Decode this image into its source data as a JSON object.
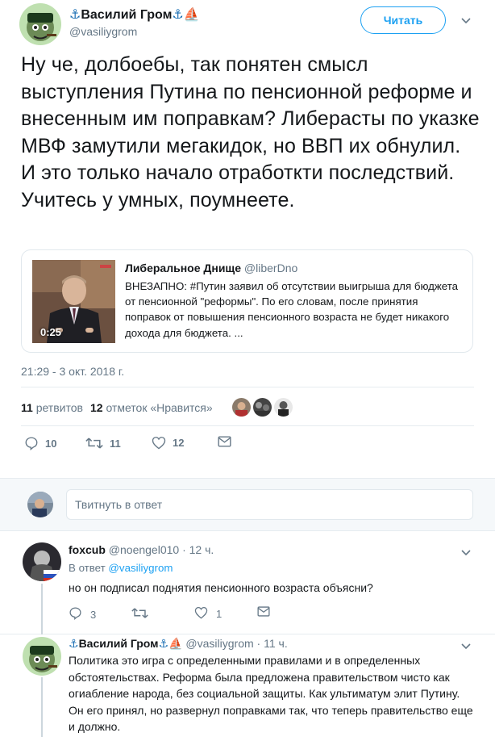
{
  "main_tweet": {
    "display_name": "Василий Гром",
    "handle": "@vasiliygrom",
    "follow_label": "Читать",
    "text": "Ну че, долбоебы, так понятен смысл выступления Путина по пенсионной реформе и внесенным им поправкам? Либерасты по указке МВФ замутили мегакидок, но ВВП их обнулил. И это только начало отработкти последствий. Учитесь у умных, поумнеете.",
    "quote": {
      "author_name": "Либеральное Днище",
      "author_handle": "@liberDno",
      "text": "ВНЕЗАПНО: #Путин заявил об отсутствии выигрыша для бюджета от пенсионной \"реформы\". По его словам, после принятия поправок от повышения пенсионного возраста не будет никакого дохода для бюджета. ...",
      "video_duration": "0:25"
    },
    "timestamp": "21:29 - 3 окт. 2018 г.",
    "retweets_count": "11",
    "retweets_label": "ретвитов",
    "likes_count": "12",
    "likes_label": "отметок «Нравится»",
    "actions": {
      "reply_count": "10",
      "retweet_count": "11",
      "like_count": "12"
    }
  },
  "reply_box": {
    "placeholder": "Твитнуть в ответ"
  },
  "replies": [
    {
      "display_name": "foxcub",
      "handle": "@noengel010",
      "time": "12 ч.",
      "in_reply_prefix": "В ответ",
      "in_reply_to": "@vasiliygrom",
      "text": "но он подписал поднятия пенсионного возраста объясни?",
      "reply_count": "3",
      "retweet_count": "",
      "like_count": "1"
    },
    {
      "display_name": "Василий Гром",
      "handle": "@vasiliygrom",
      "time": "11 ч.",
      "text": "Политика это игра с определенными правилами и в определенных обстоятельствах. Реформа была предложена правительством чисто как огиабление народа, без социальной защиты. Как ультиматум элит Путину. Он его принял, но развернул поправками так, что теперь правительство еще и должно."
    }
  ],
  "colors": {
    "accent": "#1da1f2",
    "text_primary": "#14171a",
    "text_secondary": "#657786",
    "border": "#e6ecf0",
    "reply_box_bg": "#f5f8fa"
  },
  "icons": {
    "anchor": "anchor-icon",
    "sailboat": "sailboat-icon",
    "reply": "reply-icon",
    "retweet": "retweet-icon",
    "like": "heart-icon",
    "message": "envelope-icon",
    "caret": "chevron-down-icon"
  }
}
